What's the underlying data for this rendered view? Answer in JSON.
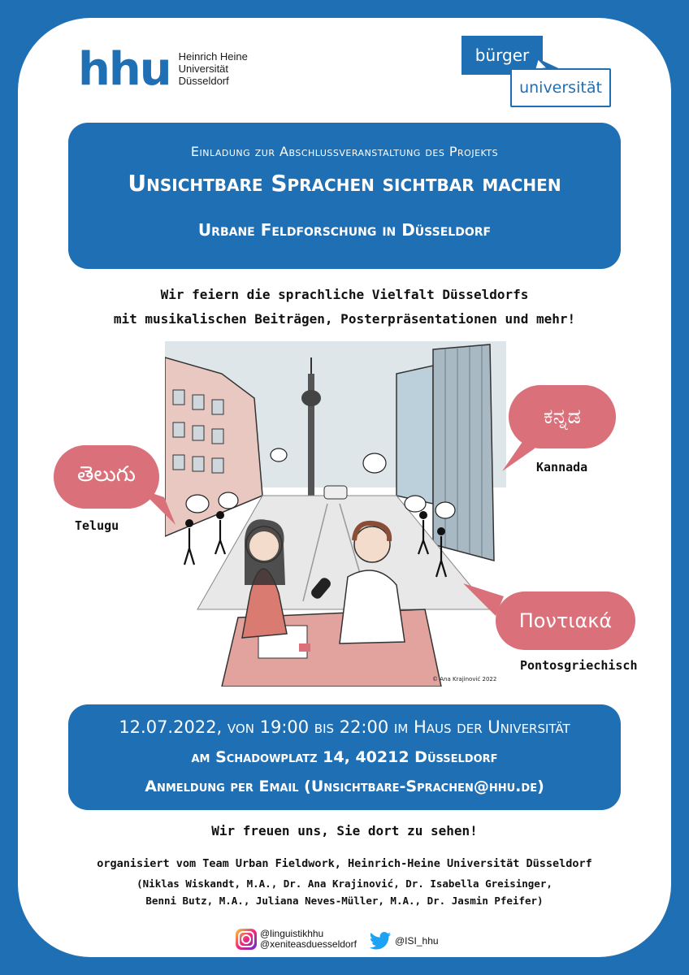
{
  "colors": {
    "brand_blue": "#1f6fb5",
    "bubble_pink": "#d9707a",
    "background": "#ffffff"
  },
  "logos": {
    "hhu_mark": "hhu",
    "hhu_name_lines": [
      "Heinrich Heine",
      "Universität",
      "Düsseldorf"
    ],
    "buerger_top": "bürger",
    "buerger_bottom": "universität"
  },
  "header_panel": {
    "invite": "Einladung zur Abschlussveranstaltung des Projekts",
    "title": "Unsichtbare Sprachen sichtbar machen",
    "subtitle": "Urbane Feldforschung in Düsseldorf"
  },
  "intro": [
    "Wir feiern die sprachliche Vielfalt Düsseldorfs",
    "mit musikalischen Beiträgen, Posterpräsentationen und mehr!"
  ],
  "illustration": {
    "credit": "© Ana Krajinović 2022"
  },
  "languages": [
    {
      "script": "తెలుగు",
      "label": "Telugu"
    },
    {
      "script": "ಕನ್ನಡ",
      "label": "Kannada"
    },
    {
      "script": "Ποντιακά",
      "label": "Pontosgriechisch"
    }
  ],
  "event_panel": {
    "date_time": "12.07.2022, von 19:00 bis 22:00 im Haus der Universität",
    "address": "am Schadowplatz 14, 40212 Düsseldorf",
    "registration": "Anmeldung per Email (Unsichtbare-Sprachen@hhu.de)"
  },
  "closing": "Wir freuen uns, Sie dort zu sehen!",
  "organizer": "organisiert vom Team Urban Fieldwork, Heinrich-Heine Universität Düsseldorf",
  "team_lines": [
    "(Niklas Wiskandt, M.A., Dr. Ana Krajinović, Dr. Isabella Greisinger,",
    "Benni Butz, M.A., Juliana Neves-Müller, M.A., Dr. Jasmin Pfeifer)"
  ],
  "social": {
    "instagram": [
      "@linguistikhhu",
      "@xeniteasduesseldorf"
    ],
    "twitter": "@ISI_hhu"
  }
}
